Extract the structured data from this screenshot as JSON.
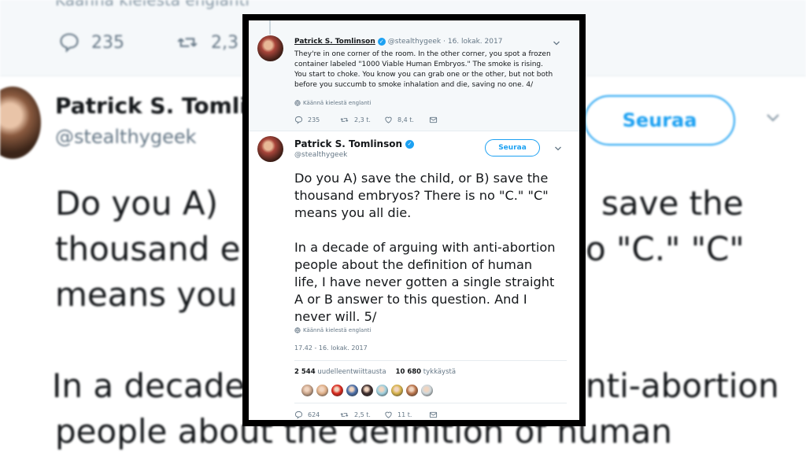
{
  "background": {
    "translate_label": "Käännä kielestä englanti",
    "reply_count": "235",
    "retweet_count": "2,3",
    "name": "Patrick S. Tomli",
    "handle": "@stealthygeek",
    "follow_label": "Seuraa",
    "left_lines": [
      "Do you A)",
      "thousand e",
      "means you",
      "In a decade",
      "people about the definition of human"
    ],
    "right_lines": [
      "save the",
      "o \"C.\" \"C\"",
      "nti-abortion"
    ]
  },
  "tweet1": {
    "name": "Patrick S. Tomlinson",
    "handle": "@stealthygeek",
    "date": "· 16. lokak. 2017",
    "text": "They're in one corner of the room. In the other corner, you spot a frozen container labeled \"1000 Viable Human Embryos.\" The smoke is rising. You start to choke. You know you can grab one or the other, but not both before you succumb to smoke inhalation and die, saving no one. 4/",
    "translate": "Käännä kielestä englanti",
    "replies": "235",
    "retweets": "2,3 t.",
    "likes": "8,4 t."
  },
  "tweet2": {
    "name": "Patrick S. Tomlinson",
    "handle": "@stealthygeek",
    "follow_label": "Seuraa",
    "text": "Do you A) save the child, or B) save the\nthousand embryos? There is no \"C.\" \"C\"\nmeans you all die.\n\nIn a decade of arguing with anti-abortion\npeople about the definition of human\nlife, I have never gotten a single straight\nA or B answer to this question. And I\nnever will. 5/",
    "translate": "Käännä kielestä englanti",
    "timestamp": "17.42 - 16. lokak. 2017",
    "retweet_count": "2 544",
    "retweet_label": "uudelleentwiittausta",
    "like_count": "10 680",
    "like_label": "tykkäystä",
    "replies": "624",
    "retweets": "2,5 t.",
    "likes": "11 t."
  },
  "colors": {
    "accent": "#1da1f2",
    "text": "#14171a",
    "secondary": "#657786",
    "liker_avatars": [
      "#c9a48a",
      "#e0b089",
      "#d9271c",
      "#4a6ea8",
      "#3b2b2b",
      "#9fd1e0",
      "#d6b24a",
      "#b8734a",
      "#cfd8dc"
    ]
  }
}
